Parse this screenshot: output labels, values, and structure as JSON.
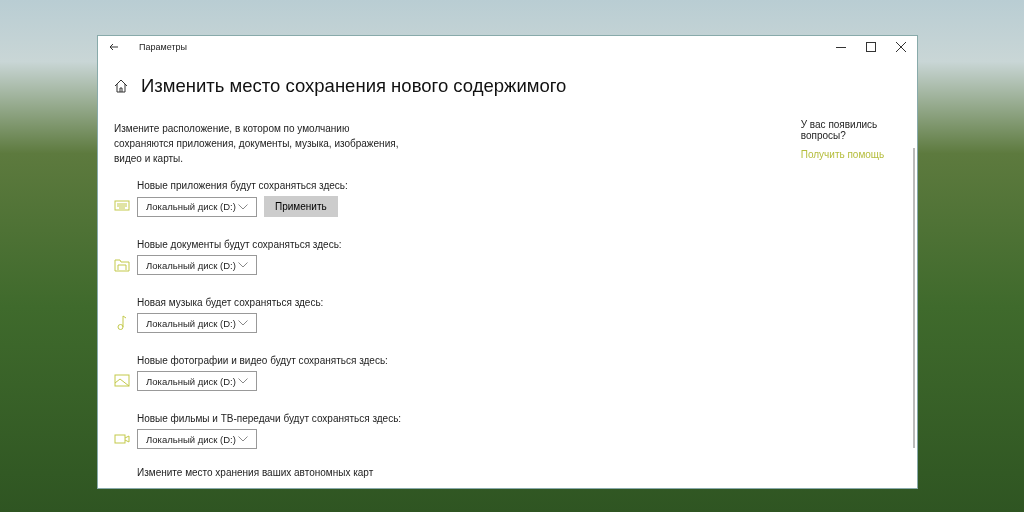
{
  "window": {
    "title": "Параметры"
  },
  "page": {
    "title": "Изменить место сохранения нового содержимого",
    "description": "Измените расположение, в котором по умолчанию сохраняются приложения, документы, музыка, изображения, видео и карты."
  },
  "locations": [
    {
      "kind": "apps",
      "label": "Новые приложения будут сохраняться здесь:",
      "value": "Локальный диск (D:)",
      "button": "Применить"
    },
    {
      "kind": "documents",
      "label": "Новые документы будут сохраняться здесь:",
      "value": "Локальный диск (D:)"
    },
    {
      "kind": "music",
      "label": "Новая музыка будет сохраняться здесь:",
      "value": "Локальный диск (D:)"
    },
    {
      "kind": "photos",
      "label": "Новые фотографии и видео будут сохраняться здесь:",
      "value": "Локальный диск (D:)"
    },
    {
      "kind": "movies",
      "label": "Новые фильмы и ТВ-передачи будут сохраняться здесь:",
      "value": "Локальный диск (D:)"
    }
  ],
  "maps_text": "Измените место хранения ваших автономных карт",
  "help": {
    "question": "У вас появились вопросы?",
    "link": "Получить помощь"
  }
}
